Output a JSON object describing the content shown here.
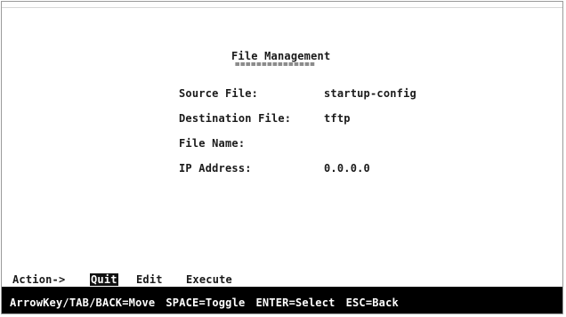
{
  "screen": {
    "title": "File Management",
    "title_underline": "===============",
    "fields": {
      "source_file": {
        "label": "Source File:",
        "value": "startup-config"
      },
      "destination_file": {
        "label": "Destination File:",
        "value": "tftp"
      },
      "file_name": {
        "label": "File Name:",
        "value": ""
      },
      "ip_address": {
        "label": "IP Address:",
        "value": "0.0.0.0"
      }
    }
  },
  "action_bar": {
    "label": "Action->",
    "items": [
      "Quit",
      "Edit",
      "Execute"
    ],
    "selected": "Quit"
  },
  "status_bar": {
    "hints": [
      "ArrowKey/TAB/BACK=Move",
      "SPACE=Toggle",
      "ENTER=Select",
      "ESC=Back"
    ]
  }
}
